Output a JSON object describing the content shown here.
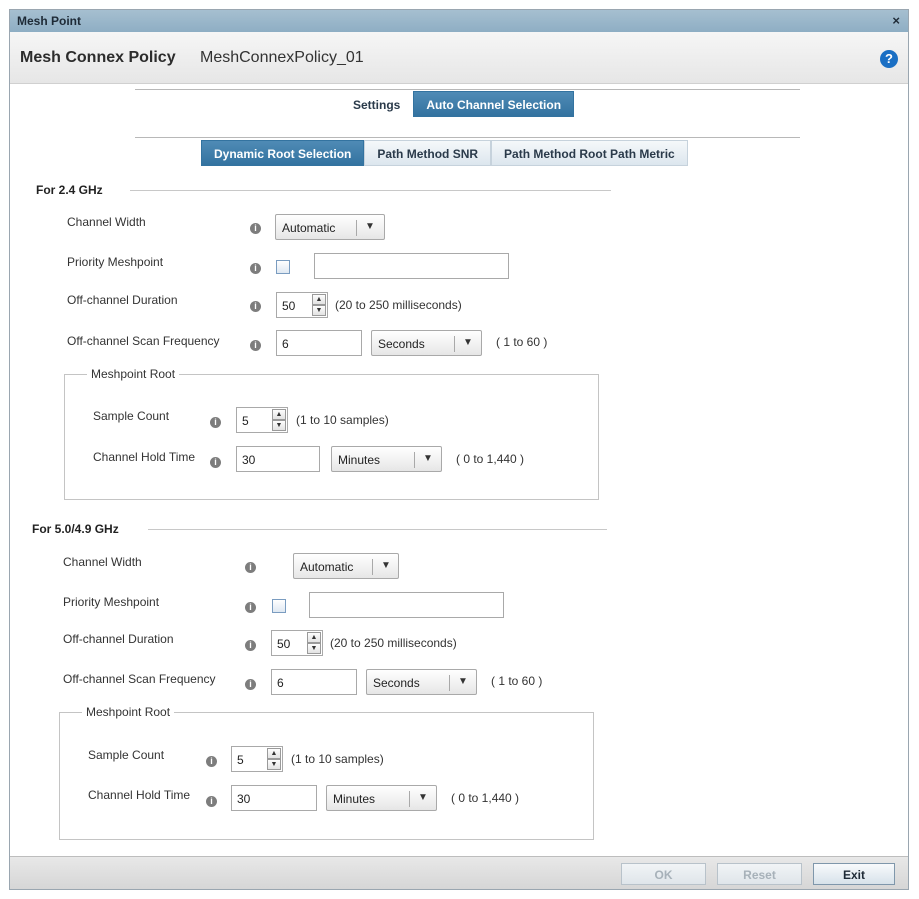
{
  "window": {
    "title": "Mesh Point",
    "close_glyph": "×"
  },
  "policy": {
    "label": "Mesh Connex Policy",
    "name": "MeshConnexPolicy_01",
    "help_glyph": "?"
  },
  "top_tabs": [
    {
      "label": "Settings",
      "active": false
    },
    {
      "label": "Auto Channel Selection",
      "active": true
    }
  ],
  "sub_tabs": [
    {
      "label": "Dynamic Root Selection",
      "active": true
    },
    {
      "label": "Path Method SNR",
      "active": false
    },
    {
      "label": "Path Method Root Path Metric",
      "active": false
    }
  ],
  "info_glyph": "i",
  "sections": [
    {
      "title": "For 2.4 GHz",
      "channel_width": {
        "label": "Channel Width",
        "value": "Automatic"
      },
      "priority_meshpoint": {
        "label": "Priority Meshpoint",
        "checked": false,
        "value": ""
      },
      "off_channel_duration": {
        "label": "Off-channel Duration",
        "value": "50",
        "hint": "(20 to 250 milliseconds)"
      },
      "off_channel_scan_frequency": {
        "label": "Off-channel Scan Frequency",
        "value": "6",
        "unit": "Seconds",
        "hint": "( 1 to 60 )"
      },
      "meshpoint_root": {
        "legend": "Meshpoint Root",
        "sample_count": {
          "label": "Sample Count",
          "value": "5",
          "hint": "(1 to 10 samples)"
        },
        "channel_hold_time": {
          "label": "Channel Hold Time",
          "value": "30",
          "unit": "Minutes",
          "hint": "( 0 to 1,440 )"
        }
      }
    },
    {
      "title": "For 5.0/4.9 GHz",
      "channel_width": {
        "label": "Channel Width",
        "value": "Automatic"
      },
      "priority_meshpoint": {
        "label": "Priority Meshpoint",
        "checked": false,
        "value": ""
      },
      "off_channel_duration": {
        "label": "Off-channel Duration",
        "value": "50",
        "hint": "(20 to 250 milliseconds)"
      },
      "off_channel_scan_frequency": {
        "label": "Off-channel Scan Frequency",
        "value": "6",
        "unit": "Seconds",
        "hint": "( 1 to 60 )"
      },
      "meshpoint_root": {
        "legend": "Meshpoint Root",
        "sample_count": {
          "label": "Sample Count",
          "value": "5",
          "hint": "(1 to 10 samples)"
        },
        "channel_hold_time": {
          "label": "Channel Hold Time",
          "value": "30",
          "unit": "Minutes",
          "hint": "( 0 to 1,440 )"
        }
      }
    }
  ],
  "footer": {
    "ok_label": "OK",
    "reset_label": "Reset",
    "exit_label": "Exit"
  },
  "glyphs": {
    "dropdown_arrow": "▼",
    "spin_up": "▲",
    "spin_down": "▼"
  },
  "icons": {
    "close": "close-icon",
    "help": "help-icon",
    "info": "info-icon",
    "dropdown": "chevron-down-icon"
  },
  "colors": {
    "title_bar": "#8eaec4",
    "active_tab": "#3373a0",
    "help_icon": "#1a6fc4"
  }
}
